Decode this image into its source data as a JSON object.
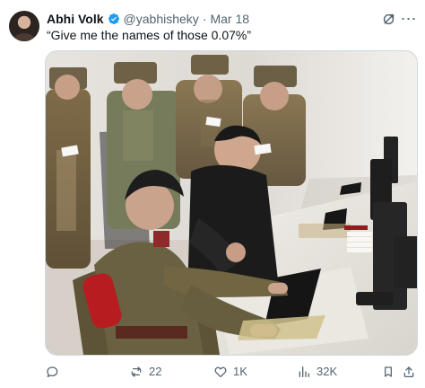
{
  "post": {
    "author": {
      "display_name": "Abhi Volk",
      "handle": "@yabhisheky",
      "verified": true
    },
    "separator": "·",
    "date": "Mar 18",
    "text": "“Give me the names of those 0.07%”",
    "actions": {
      "reply": "",
      "reposts": "22",
      "likes": "1K",
      "views": "32K"
    }
  },
  "icons": {
    "verified": "verified-badge-icon",
    "grok": "grok-icon",
    "more": "more-horizontal-icon",
    "reply": "reply-icon",
    "repost": "repost-icon",
    "like": "heart-icon",
    "views": "views-icon",
    "bookmark": "bookmark-icon",
    "share": "share-icon"
  },
  "colors": {
    "text_primary": "#0f1419",
    "text_secondary": "#536471",
    "verified_blue": "#1d9bf0",
    "border": "#cfd9de"
  }
}
